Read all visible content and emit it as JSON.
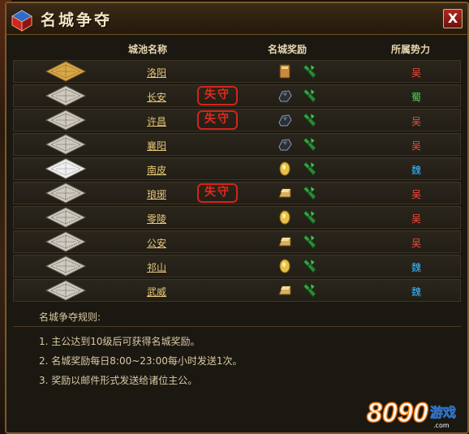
{
  "window": {
    "title": "名城争夺",
    "close_label": "X"
  },
  "columns": {
    "city_name": "城池名称",
    "reward": "名城奖励",
    "faction": "所属势力"
  },
  "lost_stamp_text": "失守",
  "cities": [
    {
      "name": "洛阳",
      "lost": false,
      "map": "gold-map",
      "reward_icon": "book-icon",
      "faction": "吴",
      "faction_color": "#ff4a3a"
    },
    {
      "name": "长安",
      "lost": true,
      "map": "silver-map",
      "reward_icon": "ore-icon",
      "faction": "蜀",
      "faction_color": "#59d35a"
    },
    {
      "name": "许昌",
      "lost": true,
      "map": "silver-map",
      "reward_icon": "ore-icon",
      "faction": "吴",
      "faction_color": "#ff4a3a"
    },
    {
      "name": "襄阳",
      "lost": false,
      "map": "silver-map",
      "reward_icon": "ore-icon",
      "faction": "吴",
      "faction_color": "#ff4a3a"
    },
    {
      "name": "南皮",
      "lost": false,
      "map": "white-map",
      "reward_icon": "coin-icon",
      "faction": "魏",
      "faction_color": "#3ab8ff"
    },
    {
      "name": "琅琊",
      "lost": true,
      "map": "silver-map",
      "reward_icon": "ingot-icon",
      "faction": "吴",
      "faction_color": "#ff4a3a"
    },
    {
      "name": "零陵",
      "lost": false,
      "map": "silver-map",
      "reward_icon": "coin-icon",
      "faction": "吴",
      "faction_color": "#ff4a3a"
    },
    {
      "name": "公安",
      "lost": false,
      "map": "silver-map",
      "reward_icon": "ingot-icon",
      "faction": "吴",
      "faction_color": "#ff4a3a"
    },
    {
      "name": "祁山",
      "lost": false,
      "map": "silver-map",
      "reward_icon": "coin-icon",
      "faction": "魏",
      "faction_color": "#3ab8ff"
    },
    {
      "name": "武威",
      "lost": false,
      "map": "silver-map",
      "reward_icon": "ingot-icon",
      "faction": "魏",
      "faction_color": "#3ab8ff"
    }
  ],
  "rules": {
    "title": "名城争夺规则:",
    "items": [
      "1. 主公达到10级后可获得名城奖励。",
      "2. 名城奖励每日8:00~23:00每小时发送1次。",
      "3. 奖励以邮件形式发送给诸位主公。"
    ]
  },
  "watermark": {
    "number": "8090",
    "text": "游戏",
    "sub": ".com"
  },
  "colors": {
    "accent": "#e9c97a",
    "stamp": "#e02a1c",
    "wei": "#3ab8ff",
    "wu": "#ff4a3a",
    "shu": "#59d35a"
  }
}
